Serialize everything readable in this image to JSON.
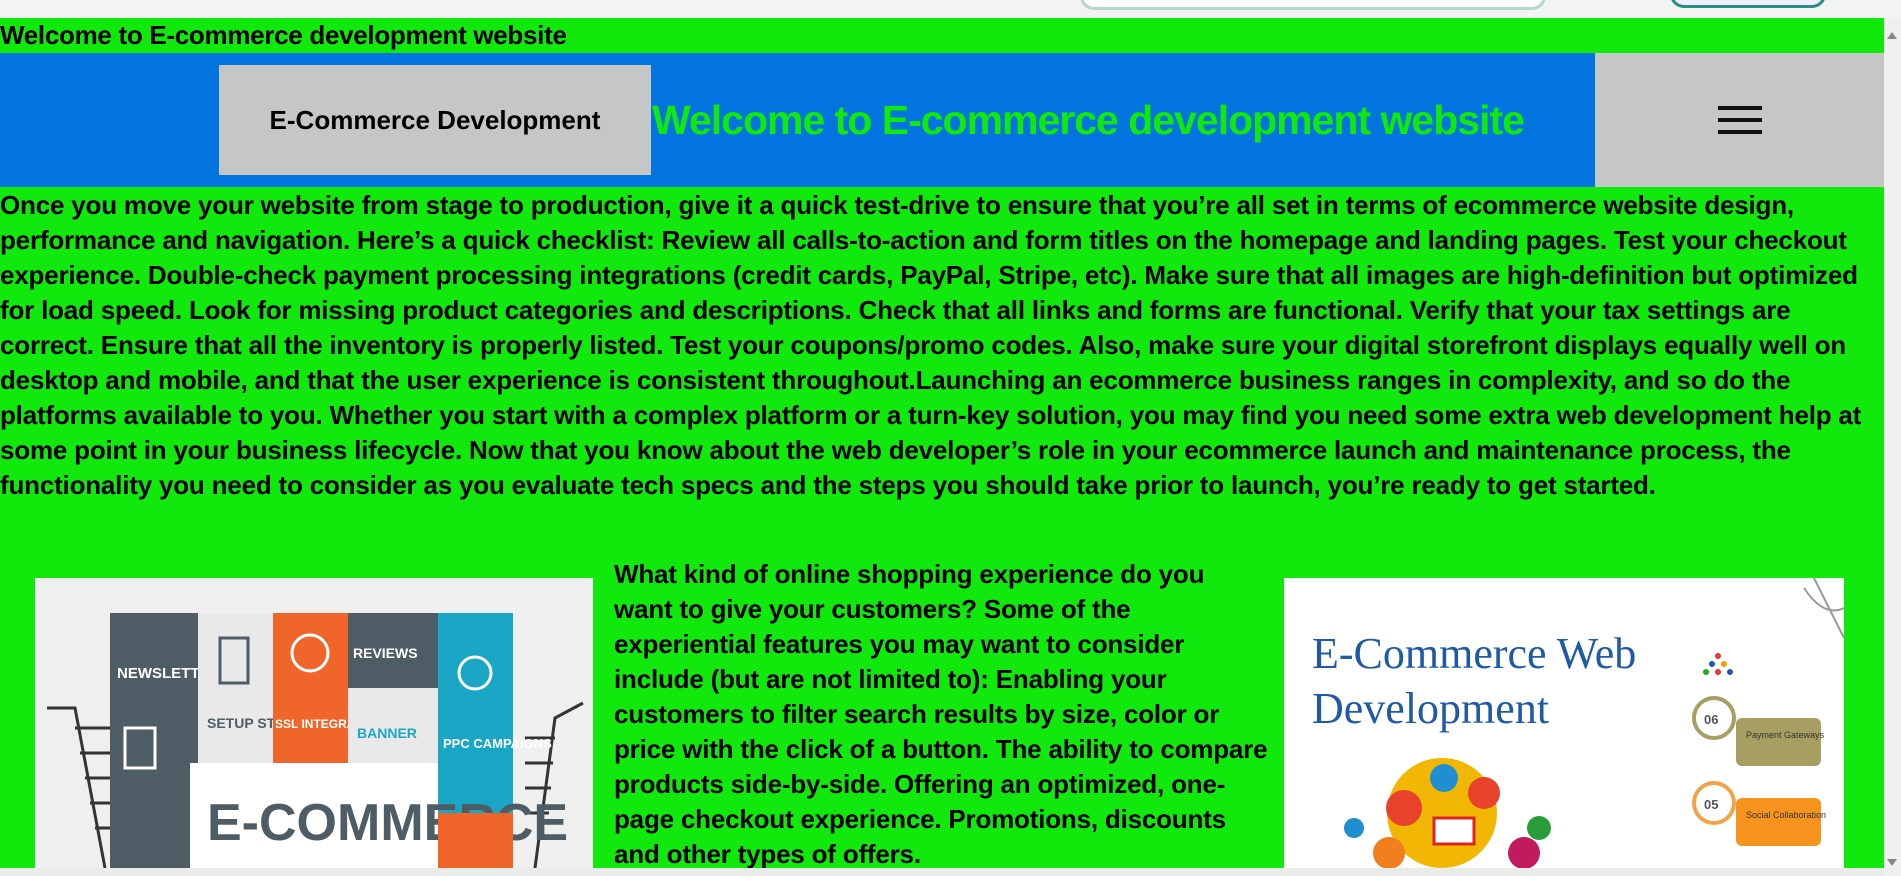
{
  "page": {
    "top_title": "Welcome to E-commerce development website"
  },
  "header": {
    "brand": "E-Commerce Development",
    "title": "Welcome to E-commerce development website",
    "menu_icon": "hamburger-menu-icon"
  },
  "intro": {
    "text": "Once you move your website from stage to production, give it a quick test-drive to ensure that you’re all set in terms of ecommerce website design, performance and navigation. Here’s a quick checklist: Review all calls-to-action and form titles on the homepage and landing pages. Test your checkout experience. Double-check payment processing integrations (credit cards, PayPal, Stripe, etc). Make sure that all images are high-definition but optimized for load speed. Look for missing product categories and descriptions. Check that all links and forms are functional. Verify that your tax settings are correct. Ensure that all the inventory is properly listed. Test your coupons/promo codes. Also, make sure your digital storefront displays equally well on desktop and mobile, and that the user experience is consistent throughout.Launching an ecommerce business ranges in complexity, and so do the platforms available to you. Whether you start with a complex platform or a turn-key solution, you may find you need some extra web development help at some point in your business lifecycle. Now that you know about the web developer’s role in your ecommerce launch and maintenance process, the functionality you need to consider as you evaluate tech specs and the steps you should take prior to launch, you’re ready to get started."
  },
  "side_text": {
    "text": "What kind of online shopping experience do you want to give your customers? Some of the experiential features you may want to consider include (but are not limited to): Enabling your customers to filter search results by size, color or price with the click of a button. The ability to compare products side-by-side. Offering an optimized, one-page checkout experience. Promotions, discounts and other types of offers."
  },
  "image_left": {
    "labels": {
      "newsletters": "NEWSLETTERS",
      "setup_stores": "SETUP STORES",
      "ssl": "SSL INTEGRATION",
      "reviews": "REVIEWS",
      "banner": "BANNER",
      "ppc": "PPC CAMPAIGNS",
      "headline": "E-COMMERCE"
    }
  },
  "image_right": {
    "headline_line1": "E-Commerce  Web",
    "headline_line2": "Development",
    "step1_number": "06",
    "step1_label": "Payment Gateways",
    "step2_number": "05",
    "step2_label": "Social Collaboration"
  },
  "colors": {
    "page_background": "#11e80b",
    "header_background": "#0174df",
    "box_background": "#c6c6c6",
    "header_title_color": "#11e80b"
  }
}
